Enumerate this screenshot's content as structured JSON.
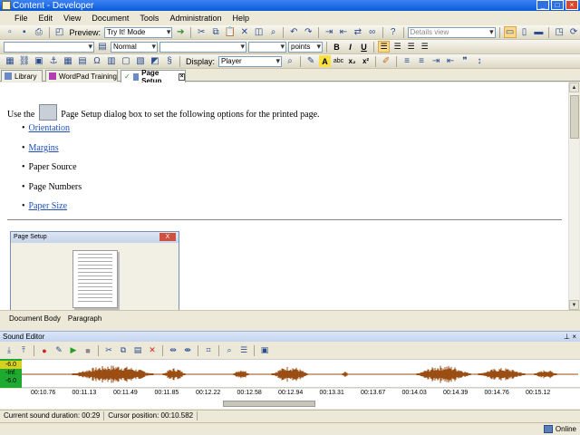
{
  "window": {
    "title": "Content - Developer"
  },
  "menu": [
    "File",
    "Edit",
    "View",
    "Document",
    "Tools",
    "Administration",
    "Help"
  ],
  "toolbar1": {
    "preview_label": "Preview:",
    "preview_mode": "Try It! Mode",
    "view_mode": "Details view"
  },
  "toolbar2": {
    "style_value": "Normal",
    "size_unit": "points"
  },
  "toolbar3": {
    "display_label": "Display:",
    "display_value": "Player"
  },
  "tabs": [
    {
      "label": "Library"
    },
    {
      "label": "WordPad Training"
    },
    {
      "label": "Page Setup",
      "active": true
    }
  ],
  "document": {
    "intro_before": "Use the",
    "intro_after": "Page Setup dialog box to set the following options for the printed page.",
    "bullets": [
      {
        "text": "Orientation",
        "link": true
      },
      {
        "text": "Margins",
        "link": true
      },
      {
        "text": "Paper Source",
        "link": false
      },
      {
        "text": "Page Numbers",
        "link": false
      },
      {
        "text": "Paper Size",
        "link": true
      }
    ],
    "dialog_title": "Page Setup",
    "dialog_close": "X"
  },
  "breadcrumb": [
    "Document Body",
    "Paragraph"
  ],
  "sound_editor": {
    "title": "Sound Editor",
    "vu_top": "-6.0",
    "vu_mid": "-Inf.",
    "vu_bot": "-6.0",
    "timeline": [
      "00:10.76",
      "00:11.13",
      "00:11.49",
      "00:11.85",
      "00:12.22",
      "00:12.58",
      "00:12.94",
      "00:13.31",
      "00:13.67",
      "00:14.03",
      "00:14.39",
      "00:14.76",
      "00:15.12"
    ],
    "duration": "Current sound duration: 00:29",
    "cursor": "Cursor position: 00:10.582",
    "waveform_color": "#9a4e14"
  },
  "status": {
    "online": "Online"
  }
}
